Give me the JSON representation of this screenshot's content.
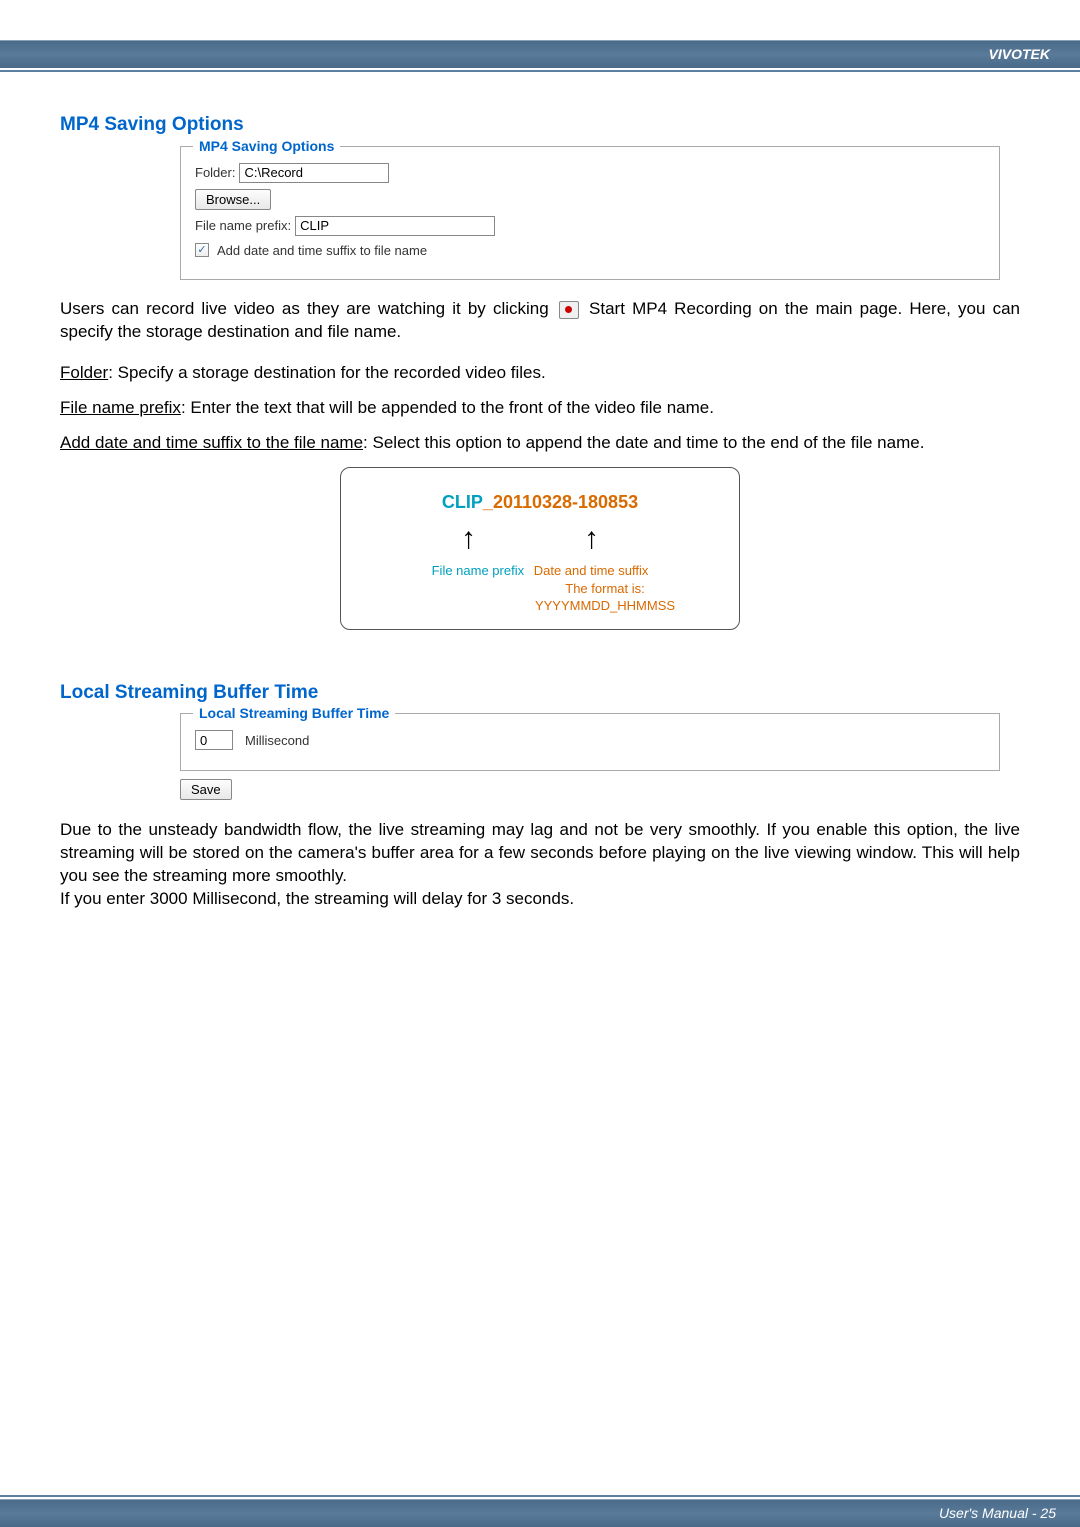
{
  "brand": "VIVOTEK",
  "sections": {
    "mp4": {
      "heading": "MP4 Saving Options",
      "legend": "MP4 Saving Options",
      "folder_label": "Folder:",
      "folder_value": "C:\\Record",
      "browse_label": "Browse...",
      "prefix_label": "File name prefix:",
      "prefix_value": "CLIP",
      "checkbox_label": "Add date and time suffix to file name",
      "intro_pre": "Users can record live video as they are watching it by clicking",
      "intro_post": "Start MP4 Recording on the main page. Here, you can specify the storage destination and file name.",
      "def_folder_term": "Folder",
      "def_folder_text": ": Specify a storage destination for the recorded video files.",
      "def_prefix_term": "File name prefix",
      "def_prefix_text": ": Enter the text that will be appended to the front of the video file name.",
      "def_suffix_term": "Add date and time suffix to the file name",
      "def_suffix_text": ": Select this option to append the date and time to the end of the file name."
    },
    "example": {
      "prefix": "CLIP",
      "sep": "_",
      "suffix": "20110328-180853",
      "label_prefix": "File name prefix",
      "label_suffix": "Date and time suffix",
      "format": "The format is: YYYYMMDD_HHMMSS"
    },
    "buffer": {
      "heading": "Local Streaming Buffer Time",
      "legend": "Local Streaming Buffer Time",
      "value": "0",
      "unit": "Millisecond",
      "save_label": "Save",
      "body": "Due to the unsteady bandwidth flow, the live streaming may lag and not be very smoothly. If you enable this option, the live streaming will be stored on the camera's buffer area for a few seconds before playing on the live viewing window. This will help you see the streaming more smoothly.",
      "body2": "If you enter 3000 Millisecond, the streaming will delay for 3 seconds."
    }
  },
  "footer": {
    "text": "User's Manual - 25"
  }
}
